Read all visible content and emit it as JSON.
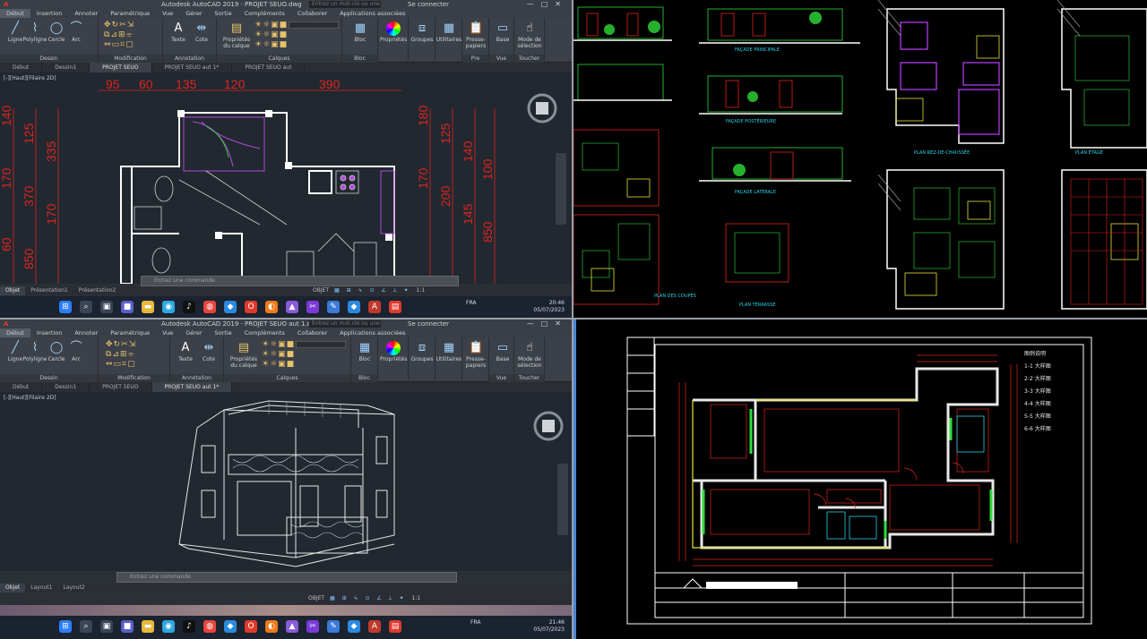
{
  "top_window": {
    "title": "Autodesk AutoCAD 2019",
    "file_title": "PROJET SEUO.dwg",
    "search_placeholder": "Entrez un mot-clé ou une phrase",
    "signin": "Se connecter",
    "menu": [
      "Début",
      "Insertion",
      "Annoter",
      "Paramétrique",
      "Vue",
      "Gérer",
      "Sortie",
      "Compléments",
      "Collaborer",
      "Applications associées"
    ],
    "active_menu": 0,
    "ribbon_tools": {
      "line": "Ligne",
      "polyline": "Polyligne",
      "circle": "Cercle",
      "arc": "Arc",
      "text": "Texte",
      "dimension": "Cote",
      "layer_props": "Propriétés du calque",
      "block": "Bloc",
      "properties": "Propriétés",
      "groups": "Groupes",
      "utilities": "Utilitaires",
      "clipboard": "Presse-papiers",
      "base": "Base",
      "view": "Mode de sélection",
      "touch": "Toucher"
    },
    "ribbon_groups": [
      "Dessin",
      "Modification",
      "Annotation",
      "Calques",
      "Bloc",
      "Pre",
      "Vue",
      "Toucher"
    ],
    "file_tabs": [
      "Début",
      "Dessin1",
      "PROJET SEUO",
      "PROJET SEUO aut 1*",
      "PROJET SEUO aut"
    ],
    "active_tab": 2,
    "viewport_label": "[-][Haut][Filaire 2D]",
    "dims_top": [
      "95",
      "60",
      "135",
      "120",
      "390"
    ],
    "dims_left": [
      "140",
      "125",
      "335",
      "170",
      "370",
      "170",
      "60",
      "850"
    ],
    "dims_right": [
      "180",
      "125",
      "140",
      "100",
      "170",
      "200",
      "145",
      "850"
    ],
    "command_placeholder": "Entrez une commande",
    "layout_tabs": [
      "Objet",
      "Présentation1",
      "Présentation2"
    ],
    "status_model": "OBJET",
    "zoom": "1:1"
  },
  "bottom_window": {
    "title": "Autodesk AutoCAD 2019",
    "file_title": "PROJET SEUO aut 1.dwg",
    "search_placeholder": "Entrez un mot-clé ou une phrase",
    "signin": "Se connecter",
    "menu": [
      "Début",
      "Insertion",
      "Annoter",
      "Paramétrique",
      "Vue",
      "Gérer",
      "Sortie",
      "Compléments",
      "Collaborer",
      "Applications associées"
    ],
    "active_menu": 0,
    "ribbon_groups": [
      "Dessin",
      "Modification",
      "Annotation",
      "Calques",
      "Bloc",
      "Vue",
      "Toucher"
    ],
    "file_tabs": [
      "Début",
      "Dessin1",
      "PROJET SEUO",
      "PROJET SEUO aut 1*"
    ],
    "active_tab": 3,
    "viewport_label": "[-][Haut][Filaire 2D]",
    "command_placeholder": "Entrez une commande",
    "layout_tabs": [
      "Objet",
      "Layout1",
      "Layout2"
    ],
    "status_model": "OBJET",
    "zoom": "1:1"
  },
  "taskbar_top": {
    "lang": "FRA",
    "time": "20:46",
    "date": "05/07/2023",
    "weather": "26°"
  },
  "taskbar_bottom": {
    "lang": "FRA",
    "time": "21:46",
    "date": "05/07/2023",
    "weather": "26°"
  },
  "tr_labels": {
    "elev_front": "FAÇADE PRINCIPALE",
    "elev_back": "FAÇADE POSTÉRIEURE",
    "elev_side": "FAÇADE LATÉRALE",
    "plan_rdc": "PLAN REZ-DE-CHAUSSÉE",
    "plan_etage": "PLAN ÉTAGE",
    "plan_terrasse": "PLAN TERRASSE",
    "plan_coupe": "PLAN DES COUPES"
  },
  "br_legend": [
    "图例说明",
    "1-1 大样图",
    "2-2 大样图",
    "3-3 大样图",
    "4-4 大样图",
    "5-5 大样图",
    "6-6 大样图"
  ],
  "colors": {
    "cad_bg": "#212830",
    "ribbon": "#3c4048",
    "dim_red": "#e0231f",
    "wall_white": "#ffffff",
    "magenta": "#c040ff",
    "green": "#2fdc3a",
    "yellow": "#e8e13a",
    "cyan": "#29d2e8"
  }
}
